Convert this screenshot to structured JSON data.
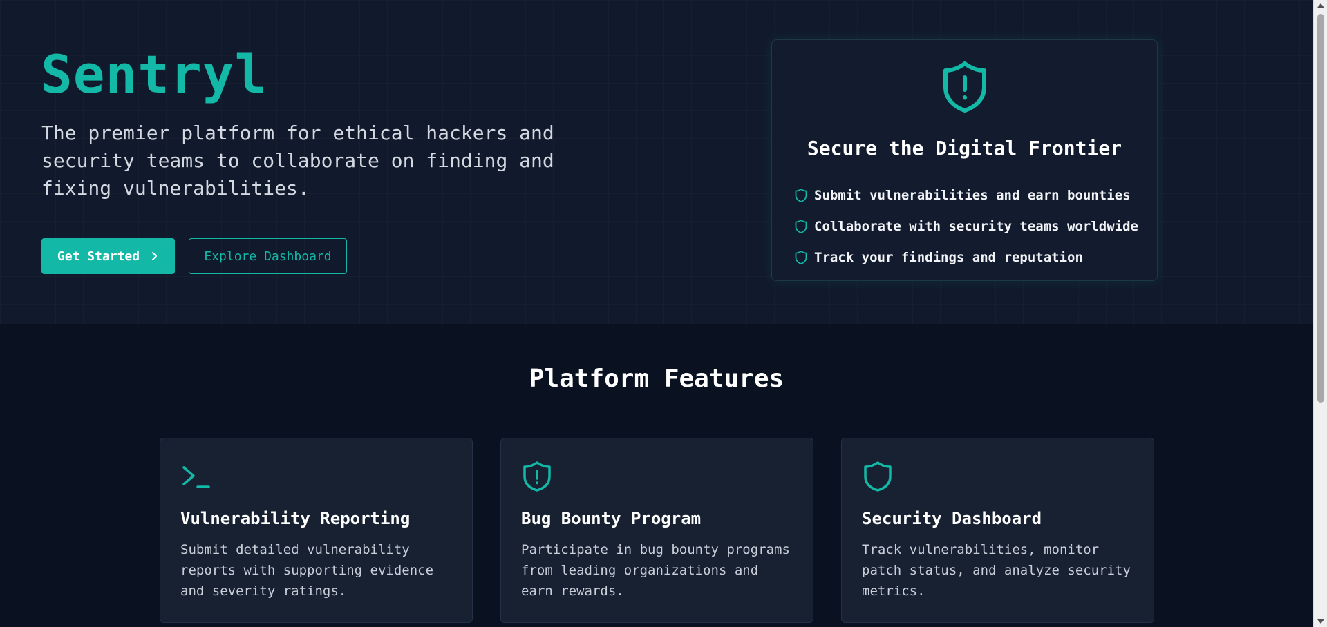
{
  "hero": {
    "brand": "Sentryl",
    "tagline": "The premier platform for ethical hackers and security teams to collaborate on finding and fixing vulnerabilities.",
    "primary_button": "Get Started",
    "primary_button_icon": "chevron-right-icon",
    "secondary_button": "Explore Dashboard"
  },
  "info_card": {
    "icon": "shield-alert-icon",
    "title": "Secure the Digital Frontier",
    "items": [
      "Submit vulnerabilities and earn bounties",
      "Collaborate with security teams worldwide",
      "Track your findings and reputation"
    ],
    "item_icon": "shield-icon"
  },
  "features": {
    "title": "Platform Features",
    "cards": [
      {
        "icon": "terminal-icon",
        "title": "Vulnerability Reporting",
        "description": "Submit detailed vulnerability reports with supporting evidence and severity ratings."
      },
      {
        "icon": "shield-alert-icon",
        "title": "Bug Bounty Program",
        "description": "Participate in bug bounty programs from leading organizations and earn rewards."
      },
      {
        "icon": "shield-icon",
        "title": "Security Dashboard",
        "description": "Track vulnerabilities, monitor patch status, and analyze security metrics."
      }
    ]
  },
  "colors": {
    "accent": "#14b8a6",
    "background": "#0a1120",
    "hero_background": "#111a2c",
    "card_background": "#172132"
  }
}
